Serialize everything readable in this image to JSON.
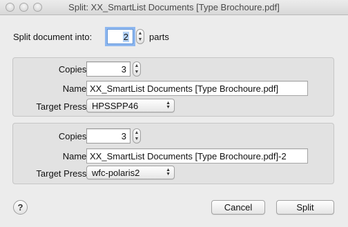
{
  "window": {
    "title": "Split: XX_SmartList Documents [Type Brochoure.pdf]"
  },
  "split": {
    "label": "Split document into:",
    "value": "2",
    "parts_label": "parts"
  },
  "groups": [
    {
      "copies_label": "Copies:",
      "copies_value": "3",
      "name_label": "Name:",
      "name_value": "XX_SmartList Documents [Type Brochoure.pdf]",
      "press_label": "Target Press:",
      "press_value": "HPSSPP46"
    },
    {
      "copies_label": "Copies:",
      "copies_value": "3",
      "name_label": "Name:",
      "name_value": "XX_SmartList Documents [Type Brochoure.pdf]-2",
      "press_label": "Target Press:",
      "press_value": "wfc-polaris2"
    }
  ],
  "buttons": {
    "help": "?",
    "cancel": "Cancel",
    "split": "Split"
  },
  "icons": {
    "stepper": "stepper-icon",
    "popup": "popup-arrows-icon"
  }
}
